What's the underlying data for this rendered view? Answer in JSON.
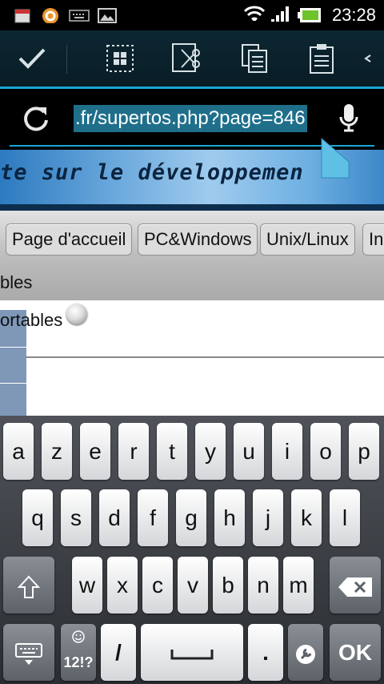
{
  "status_bar": {
    "time": "23:28",
    "left_icons": [
      "calendar-icon",
      "app-notification-icon",
      "keyboard-icon",
      "image-icon"
    ],
    "right_icons": [
      "wifi-icon",
      "signal-icon",
      "battery-icon"
    ]
  },
  "action_bar": {
    "buttons": [
      "check-icon",
      "select-all-icon",
      "cut-icon",
      "copy-icon",
      "paste-icon",
      "overflow-icon"
    ],
    "accent": "#1aa6d4"
  },
  "url_bar": {
    "url": ".fr/supertos.php?page=846"
  },
  "webpage": {
    "banner_text": "te sur le développemen",
    "nav_tabs": [
      "Page d'accueil",
      "PC&Windows",
      "Unix/Linux",
      "In"
    ],
    "subnav_label": "bles",
    "content_label": "ortables"
  },
  "keyboard": {
    "row1": [
      "a",
      "z",
      "e",
      "r",
      "t",
      "y",
      "u",
      "i",
      "o",
      "p"
    ],
    "row2": [
      "q",
      "s",
      "d",
      "f",
      "g",
      "h",
      "j",
      "k",
      "l"
    ],
    "row3": [
      "w",
      "x",
      "c",
      "v",
      "b",
      "n",
      "m"
    ],
    "symbols_label": "12!?",
    "slash_label": "/",
    "period_label": ".",
    "ok_label": "OK"
  }
}
